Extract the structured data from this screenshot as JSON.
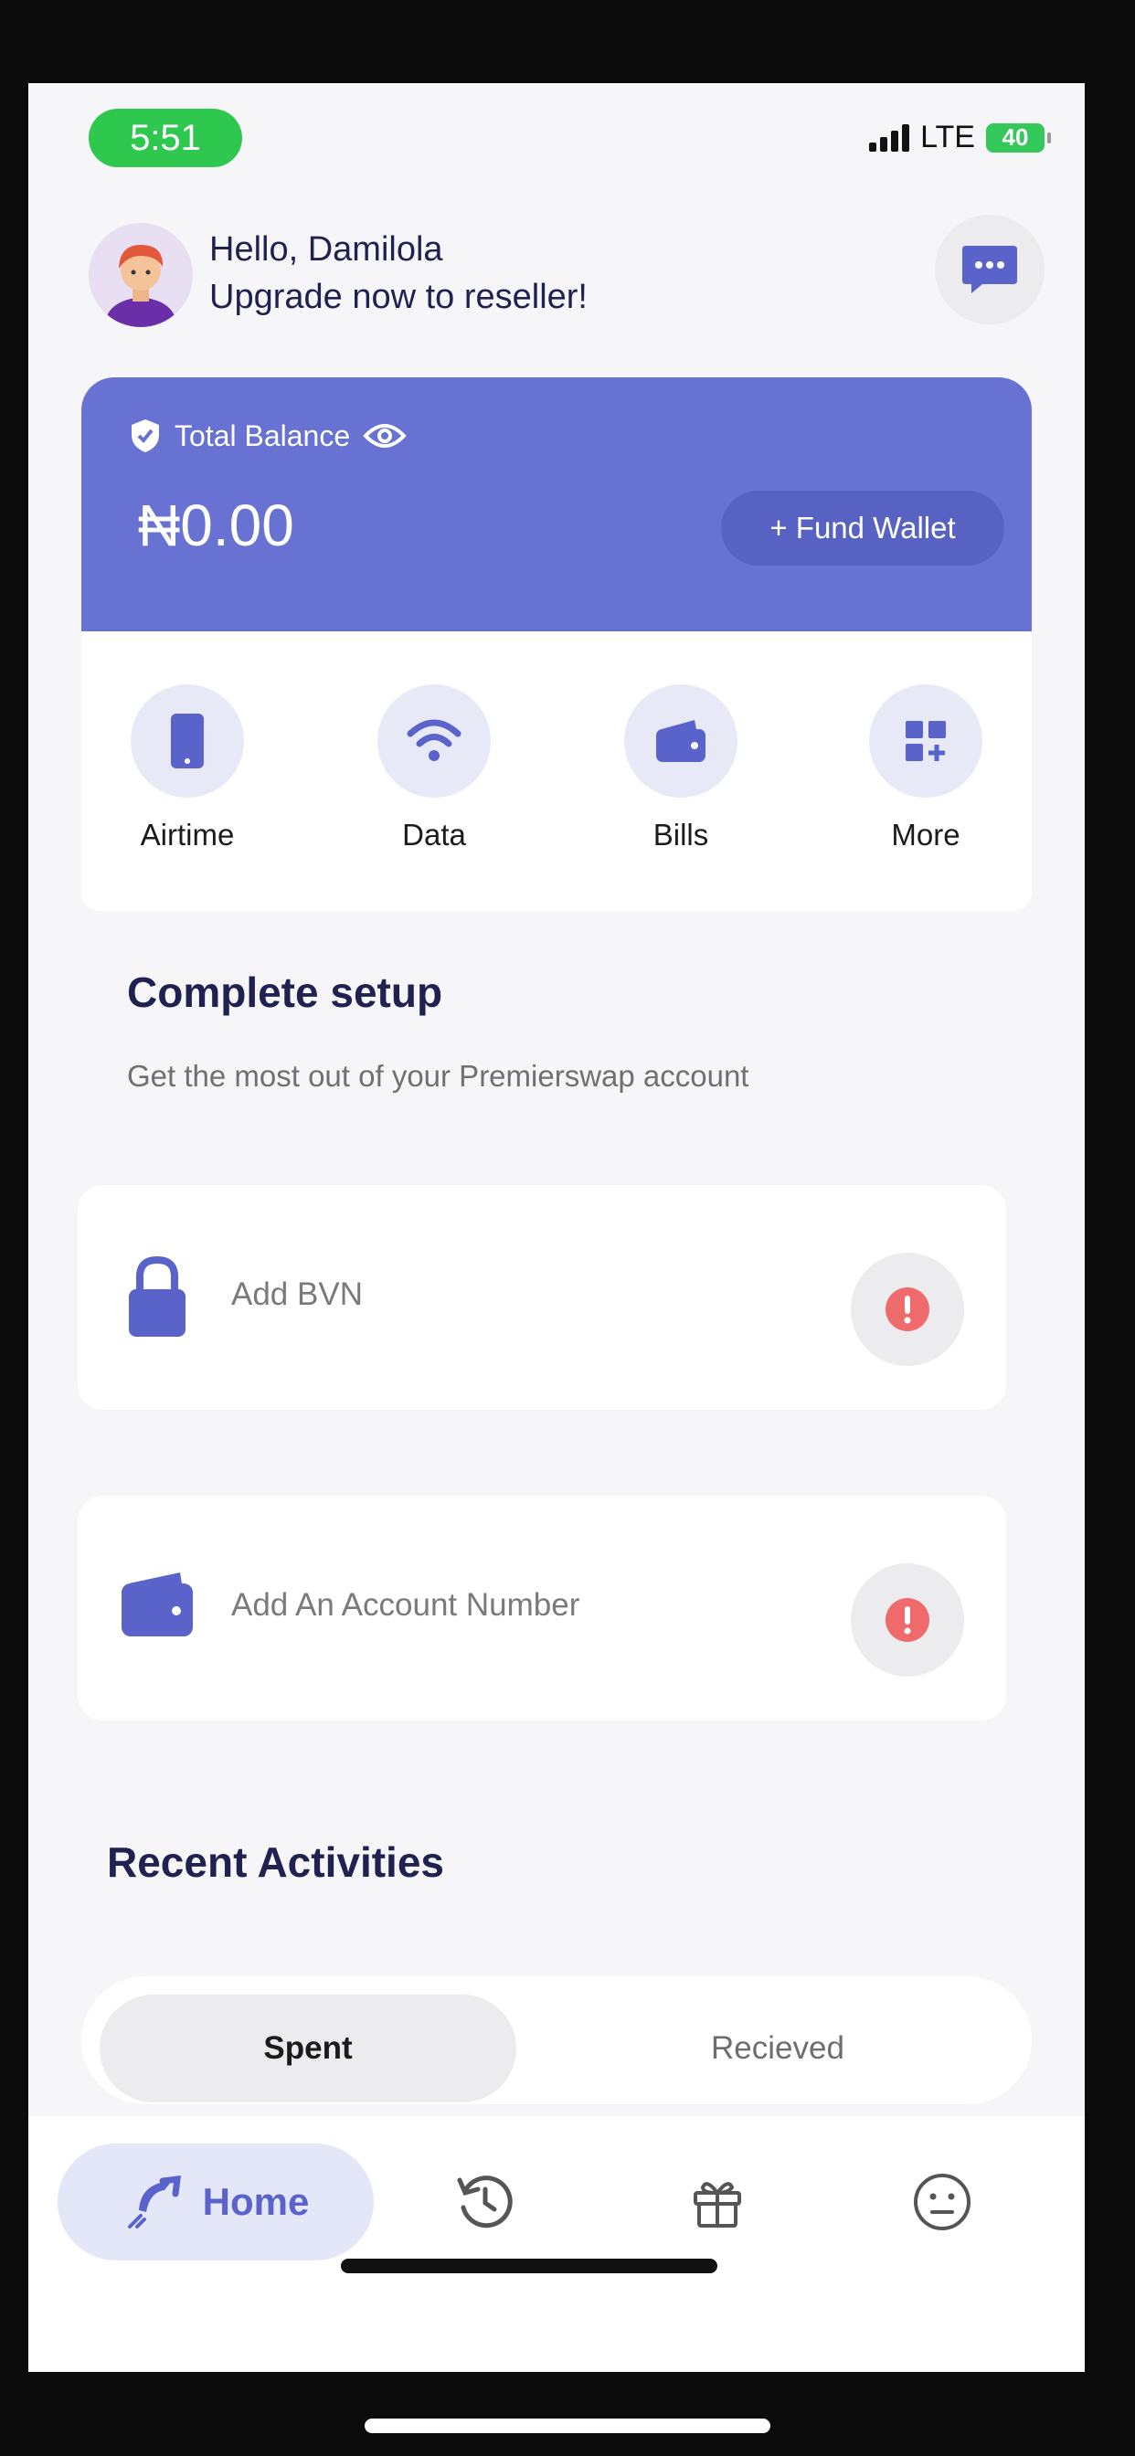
{
  "status": {
    "time": "5:51",
    "network": "LTE",
    "battery": "40"
  },
  "header": {
    "greeting": "Hello, Damilola",
    "subtitle": "Upgrade now to reseller!"
  },
  "balance": {
    "label": "Total Balance",
    "amount": "₦0.00",
    "fund_label": "+ Fund Wallet",
    "accent": "#6872d3"
  },
  "services": [
    {
      "label": "Airtime",
      "icon": "phone-icon"
    },
    {
      "label": "Data",
      "icon": "wifi-icon"
    },
    {
      "label": "Bills",
      "icon": "wallet-icon"
    },
    {
      "label": "More",
      "icon": "grid-plus-icon"
    }
  ],
  "setup": {
    "title": "Complete setup",
    "subtitle": "Get the most out of your Premierswap account",
    "items": [
      {
        "label": "Add BVN",
        "icon": "lock-icon"
      },
      {
        "label": "Add An Account Number",
        "icon": "wallet-icon"
      }
    ]
  },
  "recent": {
    "title": "Recent Activities",
    "tabs": [
      "Spent",
      "Recieved"
    ]
  },
  "nav": {
    "home_label": "Home",
    "items": [
      "home-icon",
      "history-icon",
      "gift-icon",
      "profile-icon"
    ]
  }
}
